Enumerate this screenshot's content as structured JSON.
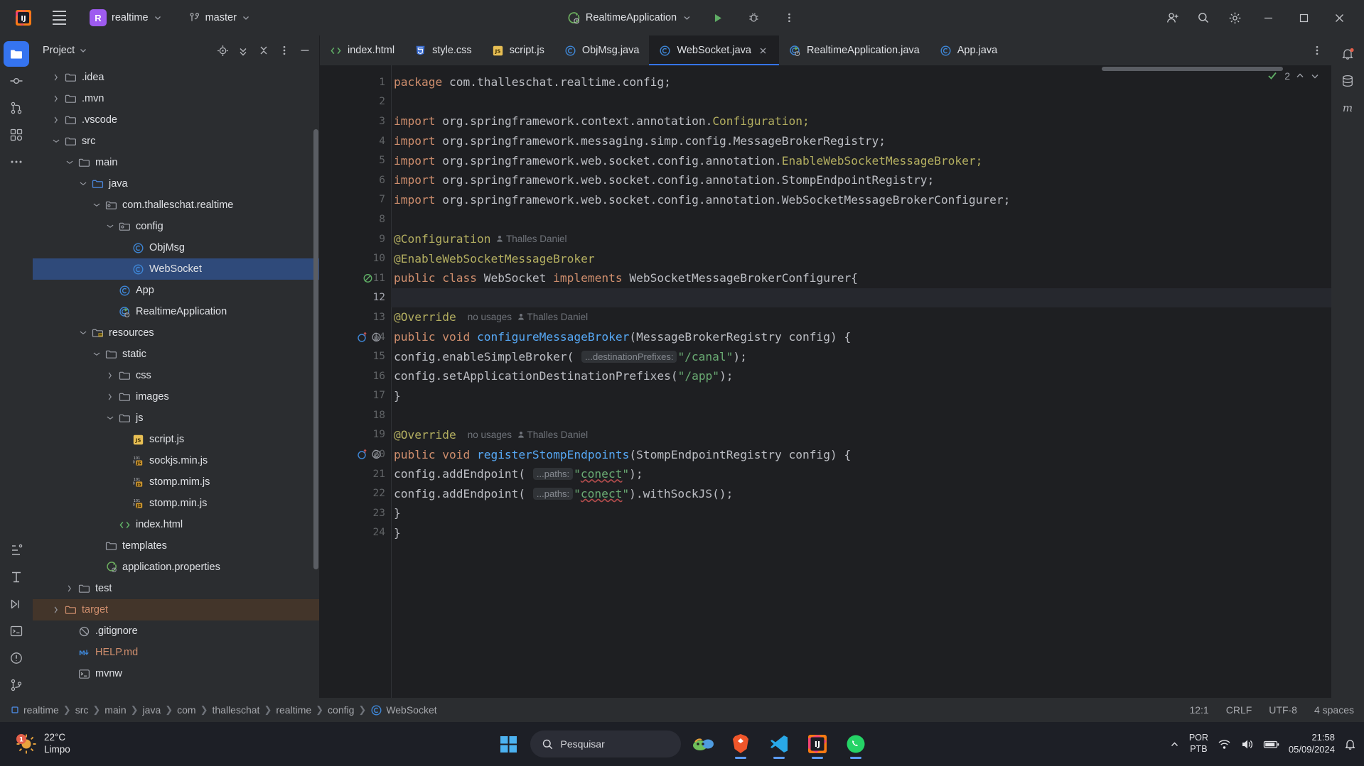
{
  "titlebar": {
    "menu_icon": "hamburger-icon",
    "project_initial": "R",
    "project_name": "realtime",
    "branch_icon": "git-branch-icon",
    "branch_name": "master",
    "run_config": "RealtimeApplication",
    "run_icon": "run-icon",
    "debug_icon": "debug-icon",
    "more_icon": "more-vertical-icon",
    "account_icon": "account-icon",
    "search_icon": "search-icon",
    "settings_icon": "gear-icon",
    "minimize_icon": "minimize-icon",
    "maximize_icon": "maximize-icon",
    "close_icon": "close-icon"
  },
  "left_rail": {
    "items": [
      {
        "name": "project-tool-window",
        "icon": "folder-icon",
        "active": true
      },
      {
        "name": "commit-tool-window",
        "icon": "commit-icon",
        "active": false
      },
      {
        "name": "pull-requests-tool-window",
        "icon": "pull-request-icon",
        "active": false
      },
      {
        "name": "plugins-tool-window",
        "icon": "plugins-icon",
        "active": false
      },
      {
        "name": "more-tool-windows",
        "icon": "more-horizontal-icon",
        "active": false
      }
    ],
    "bottom_items": [
      {
        "name": "structure-tool-window",
        "icon": "structure-icon"
      },
      {
        "name": "endpoints-tool-window",
        "icon": "endpoints-icon"
      },
      {
        "name": "services-tool-window",
        "icon": "services-run-icon"
      },
      {
        "name": "terminal-tool-window",
        "icon": "terminal-icon"
      },
      {
        "name": "problems-tool-window",
        "icon": "problems-icon"
      },
      {
        "name": "version-control-tool-window",
        "icon": "git-icon"
      }
    ]
  },
  "right_rail": {
    "items": [
      {
        "name": "notifications-tool-window",
        "icon": "bell-icon"
      },
      {
        "name": "database-tool-window",
        "icon": "database-icon"
      },
      {
        "name": "maven-tool-window",
        "icon": "maven-m-icon"
      }
    ]
  },
  "project_panel": {
    "title": "Project",
    "title_chevron": "chevron-down-icon",
    "buttons": [
      {
        "name": "select-opened-file-button",
        "icon": "target-icon"
      },
      {
        "name": "expand-all-button",
        "icon": "expand-all-icon"
      },
      {
        "name": "collapse-all-button",
        "icon": "collapse-all-icon"
      },
      {
        "name": "options-button",
        "icon": "more-vertical-icon"
      },
      {
        "name": "hide-button",
        "icon": "minimize-icon"
      }
    ],
    "tree": [
      {
        "label": ".idea",
        "indent": 2,
        "arrow": "right",
        "icon": "folder-icon",
        "state": "normal"
      },
      {
        "label": ".mvn",
        "indent": 2,
        "arrow": "right",
        "icon": "folder-icon",
        "state": "normal"
      },
      {
        "label": ".vscode",
        "indent": 2,
        "arrow": "right",
        "icon": "folder-icon",
        "state": "normal"
      },
      {
        "label": "src",
        "indent": 2,
        "arrow": "down",
        "icon": "folder-icon",
        "state": "normal"
      },
      {
        "label": "main",
        "indent": 3,
        "arrow": "down",
        "icon": "folder-icon",
        "state": "normal"
      },
      {
        "label": "java",
        "indent": 4,
        "arrow": "down",
        "icon": "source-root-icon",
        "state": "normal"
      },
      {
        "label": "com.thalleschat.realtime",
        "indent": 5,
        "arrow": "down",
        "icon": "package-icon",
        "state": "normal"
      },
      {
        "label": "config",
        "indent": 6,
        "arrow": "down",
        "icon": "package-icon",
        "state": "normal"
      },
      {
        "label": "ObjMsg",
        "indent": 7,
        "arrow": "none",
        "icon": "java-class-icon",
        "state": "normal"
      },
      {
        "label": "WebSocket",
        "indent": 7,
        "arrow": "none",
        "icon": "java-class-icon",
        "state": "selected"
      },
      {
        "label": "App",
        "indent": 6,
        "arrow": "none",
        "icon": "java-class-icon",
        "state": "normal"
      },
      {
        "label": "RealtimeApplication",
        "indent": 6,
        "arrow": "none",
        "icon": "spring-boot-class-icon",
        "state": "normal"
      },
      {
        "label": "resources",
        "indent": 4,
        "arrow": "down",
        "icon": "resource-root-icon",
        "state": "normal"
      },
      {
        "label": "static",
        "indent": 5,
        "arrow": "down",
        "icon": "folder-icon",
        "state": "normal"
      },
      {
        "label": "css",
        "indent": 6,
        "arrow": "right",
        "icon": "folder-icon",
        "state": "normal"
      },
      {
        "label": "images",
        "indent": 6,
        "arrow": "right",
        "icon": "folder-icon",
        "state": "normal"
      },
      {
        "label": "js",
        "indent": 6,
        "arrow": "down",
        "icon": "folder-icon",
        "state": "normal"
      },
      {
        "label": "script.js",
        "indent": 7,
        "arrow": "none",
        "icon": "js-icon",
        "state": "normal"
      },
      {
        "label": "sockjs.min.js",
        "indent": 7,
        "arrow": "none",
        "icon": "js-min-icon",
        "state": "normal"
      },
      {
        "label": "stomp.mim.js",
        "indent": 7,
        "arrow": "none",
        "icon": "js-min-icon",
        "state": "normal"
      },
      {
        "label": "stomp.min.js",
        "indent": 7,
        "arrow": "none",
        "icon": "js-min-icon",
        "state": "normal"
      },
      {
        "label": "index.html",
        "indent": 6,
        "arrow": "none",
        "icon": "html-icon",
        "state": "normal"
      },
      {
        "label": "templates",
        "indent": 5,
        "arrow": "none",
        "icon": "folder-icon",
        "state": "normal"
      },
      {
        "label": "application.properties",
        "indent": 5,
        "arrow": "none",
        "icon": "spring-properties-icon",
        "state": "normal"
      },
      {
        "label": "test",
        "indent": 3,
        "arrow": "right",
        "icon": "folder-icon",
        "state": "normal"
      },
      {
        "label": "target",
        "indent": 2,
        "arrow": "right",
        "icon": "folder-excluded-icon",
        "state": "target"
      },
      {
        "label": ".gitignore",
        "indent": 3,
        "arrow": "none",
        "icon": "gitignore-icon",
        "state": "normal"
      },
      {
        "label": "HELP.md",
        "indent": 3,
        "arrow": "none",
        "icon": "markdown-icon",
        "state": "orange"
      },
      {
        "label": "mvnw",
        "indent": 3,
        "arrow": "none",
        "icon": "shell-script-icon",
        "state": "normal"
      }
    ]
  },
  "tabs": [
    {
      "label": "index.html",
      "icon": "html-icon",
      "active": false,
      "closable": false
    },
    {
      "label": "style.css",
      "icon": "css-icon",
      "active": false,
      "closable": false
    },
    {
      "label": "script.js",
      "icon": "js-icon",
      "active": false,
      "closable": false
    },
    {
      "label": "ObjMsg.java",
      "icon": "java-class-icon",
      "active": false,
      "closable": false
    },
    {
      "label": "WebSocket.java",
      "icon": "java-class-icon",
      "active": true,
      "closable": true
    },
    {
      "label": "RealtimeApplication.java",
      "icon": "spring-boot-class-icon",
      "active": false,
      "closable": false
    },
    {
      "label": "App.java",
      "icon": "java-class-icon",
      "active": false,
      "closable": false
    }
  ],
  "tabbar_options_icon": "more-vertical-icon",
  "editor": {
    "inspection_count": "2",
    "inspection_icon": "inspections-ok-icon",
    "up_icon": "chevron-up-icon",
    "down_icon": "chevron-down-icon",
    "lines": [
      {
        "n": "1",
        "highlight": false,
        "gutter_icon": "none"
      },
      {
        "n": "2",
        "highlight": false,
        "gutter_icon": "none"
      },
      {
        "n": "3",
        "highlight": false,
        "gutter_icon": "none"
      },
      {
        "n": "4",
        "highlight": false,
        "gutter_icon": "none"
      },
      {
        "n": "5",
        "highlight": false,
        "gutter_icon": "none"
      },
      {
        "n": "6",
        "highlight": false,
        "gutter_icon": "none"
      },
      {
        "n": "7",
        "highlight": false,
        "gutter_icon": "none"
      },
      {
        "n": "8",
        "highlight": false,
        "gutter_icon": "none"
      },
      {
        "n": "9",
        "highlight": false,
        "gutter_icon": "none"
      },
      {
        "n": "10",
        "highlight": false,
        "gutter_icon": "none"
      },
      {
        "n": "11",
        "highlight": false,
        "gutter_icon": "bean-icon"
      },
      {
        "n": "12",
        "highlight": true,
        "gutter_icon": "none"
      },
      {
        "n": "13",
        "highlight": false,
        "gutter_icon": "none"
      },
      {
        "n": "14",
        "highlight": false,
        "gutter_icon": "override-icon"
      },
      {
        "n": "15",
        "highlight": false,
        "gutter_icon": "none"
      },
      {
        "n": "16",
        "highlight": false,
        "gutter_icon": "none"
      },
      {
        "n": "17",
        "highlight": false,
        "gutter_icon": "none"
      },
      {
        "n": "18",
        "highlight": false,
        "gutter_icon": "none"
      },
      {
        "n": "19",
        "highlight": false,
        "gutter_icon": "none"
      },
      {
        "n": "20",
        "highlight": false,
        "gutter_icon": "override-icon"
      },
      {
        "n": "21",
        "highlight": false,
        "gutter_icon": "none"
      },
      {
        "n": "22",
        "highlight": false,
        "gutter_icon": "none"
      },
      {
        "n": "23",
        "highlight": false,
        "gutter_icon": "none"
      },
      {
        "n": "24",
        "highlight": false,
        "gutter_icon": "none"
      }
    ],
    "code_text": {
      "l1": "package com.thalleschat.realtime.config;",
      "l3": "import org.springframework.context.annotation.Configuration;",
      "l4": "import org.springframework.messaging.simp.config.MessageBrokerRegistry;",
      "l5": "import org.springframework.web.socket.config.annotation.EnableWebSocketMessageBroker;",
      "l6": "import org.springframework.web.socket.config.annotation.StompEndpointRegistry;",
      "l7": "import org.springframework.web.socket.config.annotation.WebSocketMessageBrokerConfigurer;",
      "l9": "@Configuration",
      "l9_author": "Thalles Daniel",
      "l10": "@EnableWebSocketMessageBroker",
      "l11": "public class WebSocket implements WebSocketMessageBrokerConfigurer{",
      "l13": "@Override",
      "l13_usages": "no usages",
      "l13_author": "Thalles Daniel",
      "l14": "public void configureMessageBroker(MessageBrokerRegistry config) {",
      "l15_call": "config.enableSimpleBroker(",
      "l15_hint": "...destinationPrefixes:",
      "l15_arg": "\"/canal\"",
      "l16": "config.setApplicationDestinationPrefixes(\"/app\");",
      "l17": "}",
      "l19": "@Override",
      "l19_usages": "no usages",
      "l19_author": "Thalles Daniel",
      "l20": "public void registerStompEndpoints(StompEndpointRegistry config) {",
      "l21_call": "config.addEndpoint(",
      "l21_hint": "...paths:",
      "l21_arg": "\"conect\"",
      "l22_call": "config.addEndpoint(",
      "l22_hint": "...paths:",
      "l22_arg": "\"conect\"",
      "l22_tail": ").withSockJS();",
      "l23": "}",
      "l24": "}"
    }
  },
  "statusbar": {
    "breadcrumbs": [
      "realtime",
      "src",
      "main",
      "java",
      "com",
      "thalleschat",
      "realtime",
      "config",
      "WebSocket"
    ],
    "project_icon": "module-icon",
    "class_icon": "java-class-icon",
    "caret_position": "12:1",
    "line_separator": "CRLF",
    "encoding": "UTF-8",
    "indent": "4 spaces"
  },
  "taskbar": {
    "weather_temp": "22°C",
    "weather_desc": "Limpo",
    "weather_icon": "weather-clear-icon",
    "notification_badge": "1",
    "start_icon": "windows-start-icon",
    "search_placeholder": "Pesquisar",
    "search_icon": "search-icon",
    "apps": [
      {
        "name": "taskbar-copilot",
        "icon": "copilot-icon",
        "running": false
      },
      {
        "name": "taskbar-brave",
        "icon": "brave-browser-icon",
        "running": true
      },
      {
        "name": "taskbar-vscode",
        "icon": "vscode-icon",
        "running": true
      },
      {
        "name": "taskbar-intellij",
        "icon": "intellij-idea-icon",
        "running": true
      },
      {
        "name": "taskbar-whatsapp",
        "icon": "whatsapp-icon",
        "running": true
      }
    ],
    "tray": {
      "chevron_icon": "chevron-up-icon",
      "lang_line1": "POR",
      "lang_line2": "PTB",
      "wifi_icon": "wifi-icon",
      "volume_icon": "volume-icon",
      "battery_icon": "battery-icon",
      "notification_icon": "bell-icon"
    },
    "clock_time": "21:58",
    "clock_date": "05/09/2024"
  }
}
